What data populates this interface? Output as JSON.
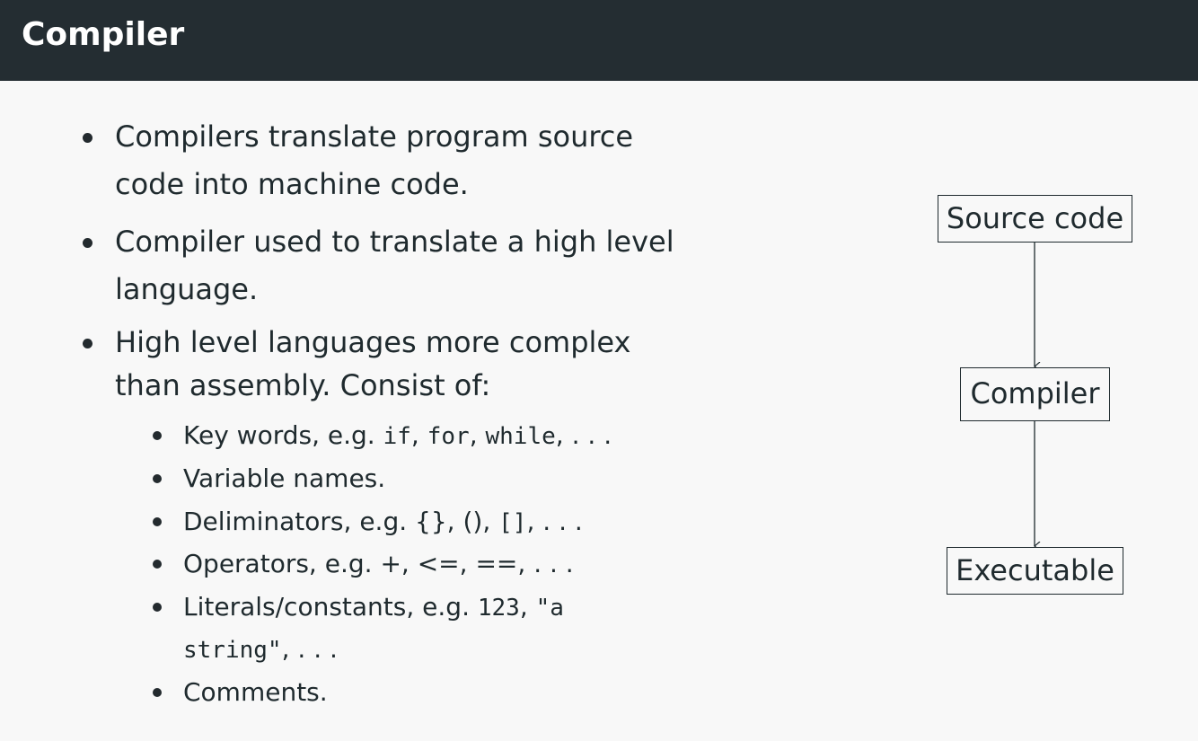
{
  "header": {
    "title": "Compiler"
  },
  "bullets": [
    {
      "lines": [
        "Compilers translate program source",
        "code into machine code."
      ]
    },
    {
      "lines": [
        "Compiler used to translate a high level",
        "language."
      ]
    },
    {
      "lines": [
        "High level languages more complex",
        "than assembly.  Consist of:"
      ],
      "subitems": [
        {
          "label": "Key words, e.g.",
          "examples": [
            "if",
            "for",
            "while"
          ],
          "ellipsis": ". . ."
        },
        {
          "label": "Variable names."
        },
        {
          "label": "Deliminators, e.g.",
          "examples": [
            "{}",
            "()",
            "[]"
          ],
          "ellipsis": ". . ."
        },
        {
          "label": "Operators, e.g.",
          "examples": [
            "+",
            "<=",
            "=="
          ],
          "ellipsis": ". . ."
        },
        {
          "label": "Literals/constants, e.g.",
          "examples": [
            "123",
            "\"a",
            "string\""
          ],
          "ellipsis": ". . ."
        },
        {
          "label": "Comments."
        }
      ]
    }
  ],
  "diagram": {
    "nodes": [
      "Source code",
      "Compiler",
      "Executable"
    ]
  },
  "colors": {
    "header_background": "#242d32",
    "page_background": "#f8f8f8",
    "text": "#1f2a2e"
  }
}
